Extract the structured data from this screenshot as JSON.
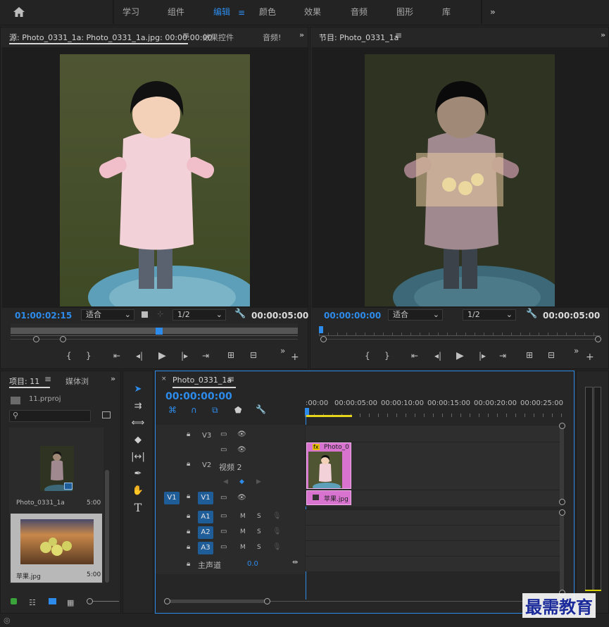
{
  "workspace": {
    "tabs": [
      "学习",
      "组件",
      "编辑",
      "颜色",
      "效果",
      "音频",
      "图形",
      "库"
    ],
    "active": "编辑",
    "more": "»"
  },
  "source": {
    "tab": "源: Photo_0331_1a: Photo_0331_1a.jpg: 00:00:00:00",
    "tab2": "效果控件",
    "tab3": "音频!",
    "timecode": "01:00:02:15",
    "fit": "适合",
    "res": "1/2",
    "duration": "00:00:05:00",
    "more": "»"
  },
  "program": {
    "tab": "节目: Photo_0331_1a",
    "timecode": "00:00:00:00",
    "fit": "适合",
    "res": "1/2",
    "duration": "00:00:05:00",
    "more": "»"
  },
  "project": {
    "tab": "项目: 11",
    "tab2": "媒体浏",
    "more": "»",
    "file": "11.prproj",
    "items": [
      {
        "name": "Photo_0331_1a",
        "duration": "5:00"
      },
      {
        "name": "苹果.jpg",
        "duration": "5:00"
      }
    ]
  },
  "timeline": {
    "tab": "Photo_0331_1a",
    "timecode": "00:00:00:00",
    "ruler": [
      ":00:00",
      "00:00:05:00",
      "00:00:10:00",
      "00:00:15:00",
      "00:00:20:00",
      "00:00:25:00"
    ],
    "tracks": {
      "v3": "V3",
      "v2": "V2",
      "v2name": "视频 2",
      "v1": "V1",
      "v1src": "V1",
      "a1": "A1",
      "a2": "A2",
      "a3": "A3",
      "mix": "主声道",
      "mixval": "0.0",
      "m": "M",
      "s": "S"
    },
    "clips": {
      "v2": "Photo_0",
      "v1": "苹果.jpg",
      "fx": "fx"
    }
  },
  "watermark": "最需教育"
}
